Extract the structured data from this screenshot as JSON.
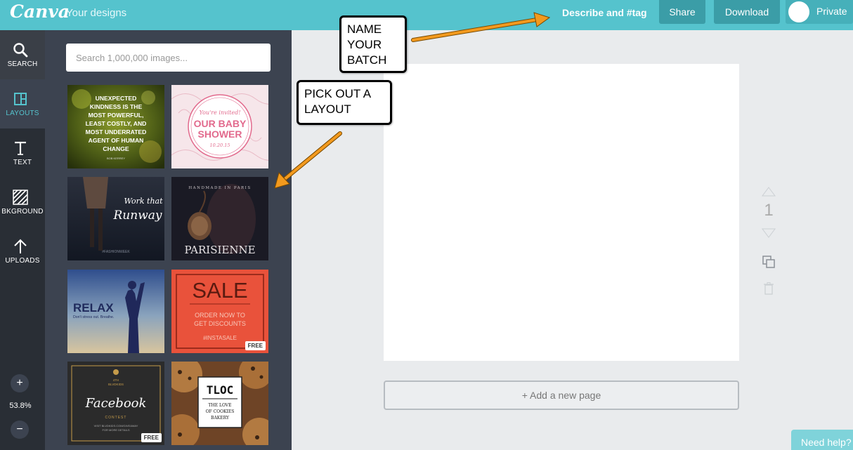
{
  "app": {
    "logo": "Canva",
    "nav_link": "Your designs",
    "describe_label": "Describe and #tag",
    "share_label": "Share",
    "download_label": "Download",
    "privacy_label": "Private"
  },
  "sidebar": {
    "items": [
      {
        "label": "SEARCH",
        "icon": "search-icon"
      },
      {
        "label": "LAYOUTS",
        "icon": "layouts-icon"
      },
      {
        "label": "TEXT",
        "icon": "text-icon"
      },
      {
        "label": "BKGROUND",
        "icon": "background-icon"
      },
      {
        "label": "UPLOADS",
        "icon": "upload-icon"
      }
    ],
    "zoom_in": "+",
    "zoom_out": "−",
    "zoom_level": "53.8%"
  },
  "panel": {
    "search_placeholder": "Search 1,000,000 images...",
    "layouts": [
      {
        "text": [
          "UNEXPECTED",
          "KINDNESS IS THE",
          "MOST POWERFUL,",
          "LEAST COSTLY, AND",
          "MOST UNDERRATED",
          "AGENT OF HUMAN",
          "CHANGE"
        ],
        "author": "BOB KERREY"
      },
      {
        "script": "You're invited!",
        "title": [
          "OUR BABY",
          "SHOWER"
        ],
        "date": "10.20.15"
      },
      {
        "script": [
          "Work that",
          "Runway"
        ],
        "tag": "#FASHIONWEEK"
      },
      {
        "top": "HANDMADE IN PARIS",
        "title": "PARISIENNE"
      },
      {
        "title": "RELAX",
        "subtitle": "Don't stress out. Breathe."
      },
      {
        "title": "SALE",
        "lines": [
          "ORDER NOW TO",
          "GET DISCOUNTS"
        ],
        "tag": "#INSTASALE",
        "badge": "FREE"
      },
      {
        "top": [
          "4TH",
          "BLVDKIDS"
        ],
        "title": "Facebook",
        "sub": "CONTEST",
        "fine": [
          "VISIT BLVDKIDS.COM/GIVEAWAY",
          "FOR MORE DETAILS"
        ],
        "badge": "FREE"
      },
      {
        "title": "TLOC",
        "lines": [
          "THE LOVE",
          "OF COOKIES",
          "BAKERY"
        ]
      }
    ]
  },
  "canvas": {
    "page_number": "1",
    "add_page_label": "+ Add a new page"
  },
  "help_label": "Need help?",
  "callouts": {
    "name_batch": [
      "NAME",
      "YOUR",
      "BATCH"
    ],
    "pick_layout": [
      "PICK OUT A",
      "LAYOUT"
    ]
  },
  "colors": {
    "topbar": "#55c3cd",
    "rail": "#292e35",
    "panel": "#3c4350",
    "accent": "#55c3cd",
    "arrow": "#f39a1e"
  }
}
